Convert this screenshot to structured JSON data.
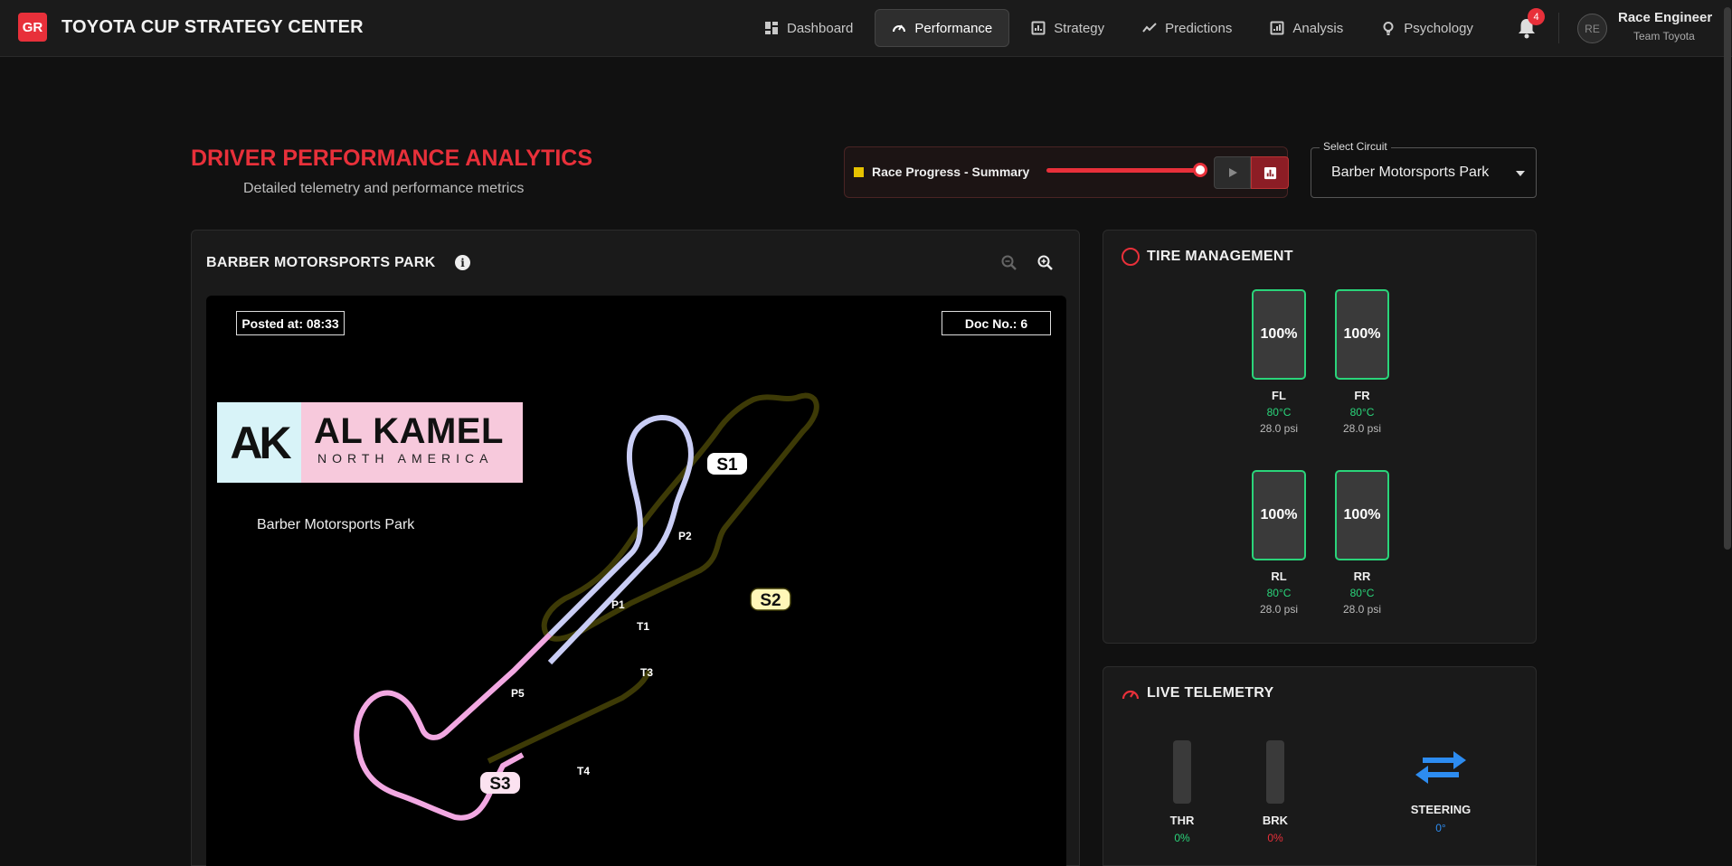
{
  "app": {
    "logo_text": "GR",
    "title": "TOYOTA CUP STRATEGY CENTER"
  },
  "nav": {
    "items": [
      {
        "label": "Dashboard",
        "icon": "dashboard-icon"
      },
      {
        "label": "Performance",
        "icon": "speedometer-icon",
        "active": true
      },
      {
        "label": "Strategy",
        "icon": "bar-chart-icon"
      },
      {
        "label": "Predictions",
        "icon": "trend-line-icon"
      },
      {
        "label": "Analysis",
        "icon": "analytics-icon"
      },
      {
        "label": "Psychology",
        "icon": "lightbulb-icon"
      }
    ]
  },
  "notifications": {
    "count": "4",
    "icon": "bell-icon"
  },
  "user": {
    "initials": "RE",
    "name": "Race Engineer",
    "team": "Team Toyota"
  },
  "header": {
    "title": "DRIVER PERFORMANCE ANALYTICS",
    "subtitle": "Detailed telemetry and performance metrics"
  },
  "race_progress": {
    "label": "Race Progress - Summary",
    "value_fraction": 1.0
  },
  "circuit_select": {
    "legend": "Select Circuit",
    "value": "Barber Motorsports Park"
  },
  "track_panel": {
    "title": "BARBER MOTORSPORTS PARK",
    "posted": "Posted at: 08:33",
    "doc_no": "Doc No.: 6",
    "logo_mark": "AK",
    "logo_name": "AL KAMEL",
    "logo_sub": "NORTH AMERICA",
    "caption": "Barber Motorsports Park",
    "sectors": [
      "S1",
      "S2",
      "S3"
    ],
    "markers": [
      "P2",
      "P1",
      "T1",
      "T3",
      "P5",
      "T4"
    ]
  },
  "tires": {
    "title": "TIRE MANAGEMENT",
    "items": [
      {
        "pos": "FL",
        "wear": "100%",
        "temp": "80°C",
        "psi": "28.0 psi"
      },
      {
        "pos": "FR",
        "wear": "100%",
        "temp": "80°C",
        "psi": "28.0 psi"
      },
      {
        "pos": "RL",
        "wear": "100%",
        "temp": "80°C",
        "psi": "28.0 psi"
      },
      {
        "pos": "RR",
        "wear": "100%",
        "temp": "80°C",
        "psi": "28.0 psi"
      }
    ]
  },
  "telemetry": {
    "title": "LIVE TELEMETRY",
    "throttle": {
      "label": "THR",
      "value": "0%"
    },
    "brake": {
      "label": "BRK",
      "value": "0%"
    },
    "steering": {
      "label": "STEERING",
      "value": "0°"
    }
  },
  "colors": {
    "accent": "#e8303a",
    "good": "#2ad47a",
    "steer": "#2d8cf0",
    "sector1": "#c9cdf5",
    "sector2": "#3d3a06",
    "sector3": "#f2a8e2"
  }
}
